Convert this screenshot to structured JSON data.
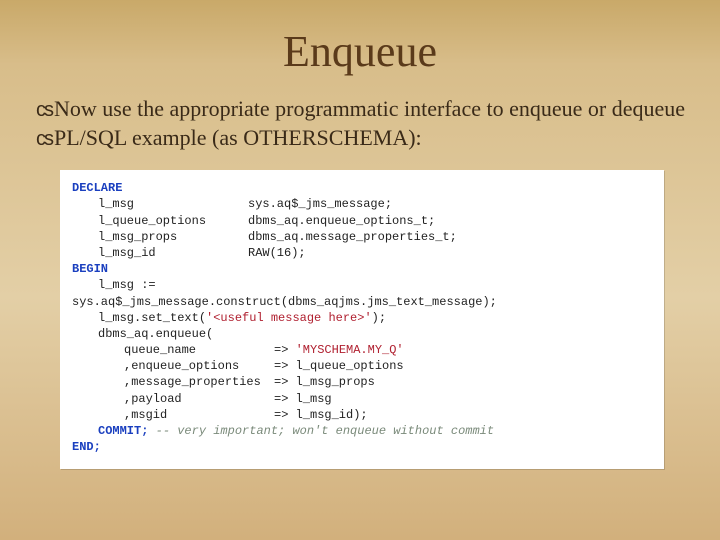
{
  "title": "Enqueue",
  "bullets": {
    "b1": "Now use the appropriate programmatic interface to enqueue or dequeue",
    "b2": "PL/SQL example (as OTHERSCHEMA):"
  },
  "code": {
    "kw_declare": "DECLARE",
    "d1_name": "l_msg",
    "d1_type": "sys.aq$_jms_message;",
    "d2_name": "l_queue_options",
    "d2_type": "dbms_aq.enqueue_options_t;",
    "d3_name": "l_msg_props",
    "d3_type": "dbms_aq.message_properties_t;",
    "d4_name": "l_msg_id",
    "d4_type": "RAW(16);",
    "kw_begin": "BEGIN",
    "l1": "l_msg :=",
    "l2": "sys.aq$_jms_message.construct(dbms_aqjms.jms_text_message);",
    "l3a": "l_msg.set_text(",
    "l3b": "'<useful message here>'",
    "l3c": ");",
    "l4": "dbms_aq.enqueue(",
    "p1_label": " queue_name",
    "p1_arrow": "=>",
    "p1_val": "'MYSCHEMA.MY_Q'",
    "p2_label": ",enqueue_options",
    "p2_val": "=> l_queue_options",
    "p3_label": ",message_properties",
    "p3_val": "=> l_msg_props",
    "p4_label": ",payload",
    "p4_val": "=> l_msg",
    "p5_label": ",msgid",
    "p5_val": "=> l_msg_id);",
    "kw_commit": "COMMIT;",
    "commit_comment": " -- very important; won't enqueue without commit",
    "kw_end": "END;"
  }
}
